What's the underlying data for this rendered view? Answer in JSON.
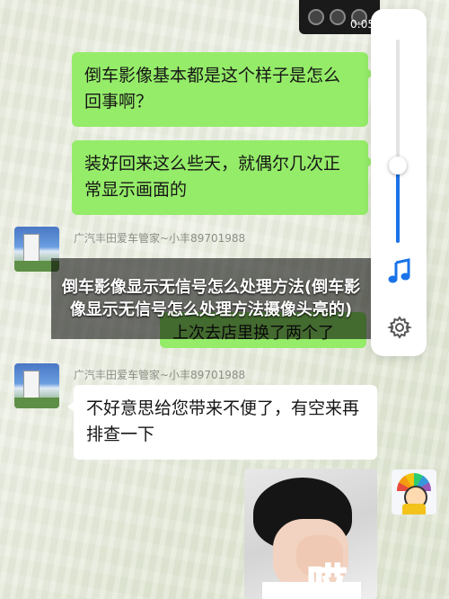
{
  "video": {
    "timestamp": "0:05"
  },
  "messages": {
    "m1": "倒车影像基本都是这个样子是怎么回事啊？",
    "m2": "装好回来这么些天，就偶尔几次正常显示画面的",
    "sender1": "广汽丰田爱车管家~小丰89701988",
    "m3_partial": "上次去店里换了两个了",
    "sender2": "广汽丰田爱车管家~小丰89701988",
    "m4": "不好意思给您带来不便了，有空来再排查一下",
    "sticker_text": "哎"
  },
  "overlay": {
    "title": "倒车影像显示无信号怎么处理方法(倒车影像显示无信号怎么处理方法摄像头亮的)"
  },
  "volume_panel": {
    "level": 0.38,
    "accent": "#1a73e8",
    "icons": [
      "music-icon",
      "gear-icon"
    ]
  }
}
